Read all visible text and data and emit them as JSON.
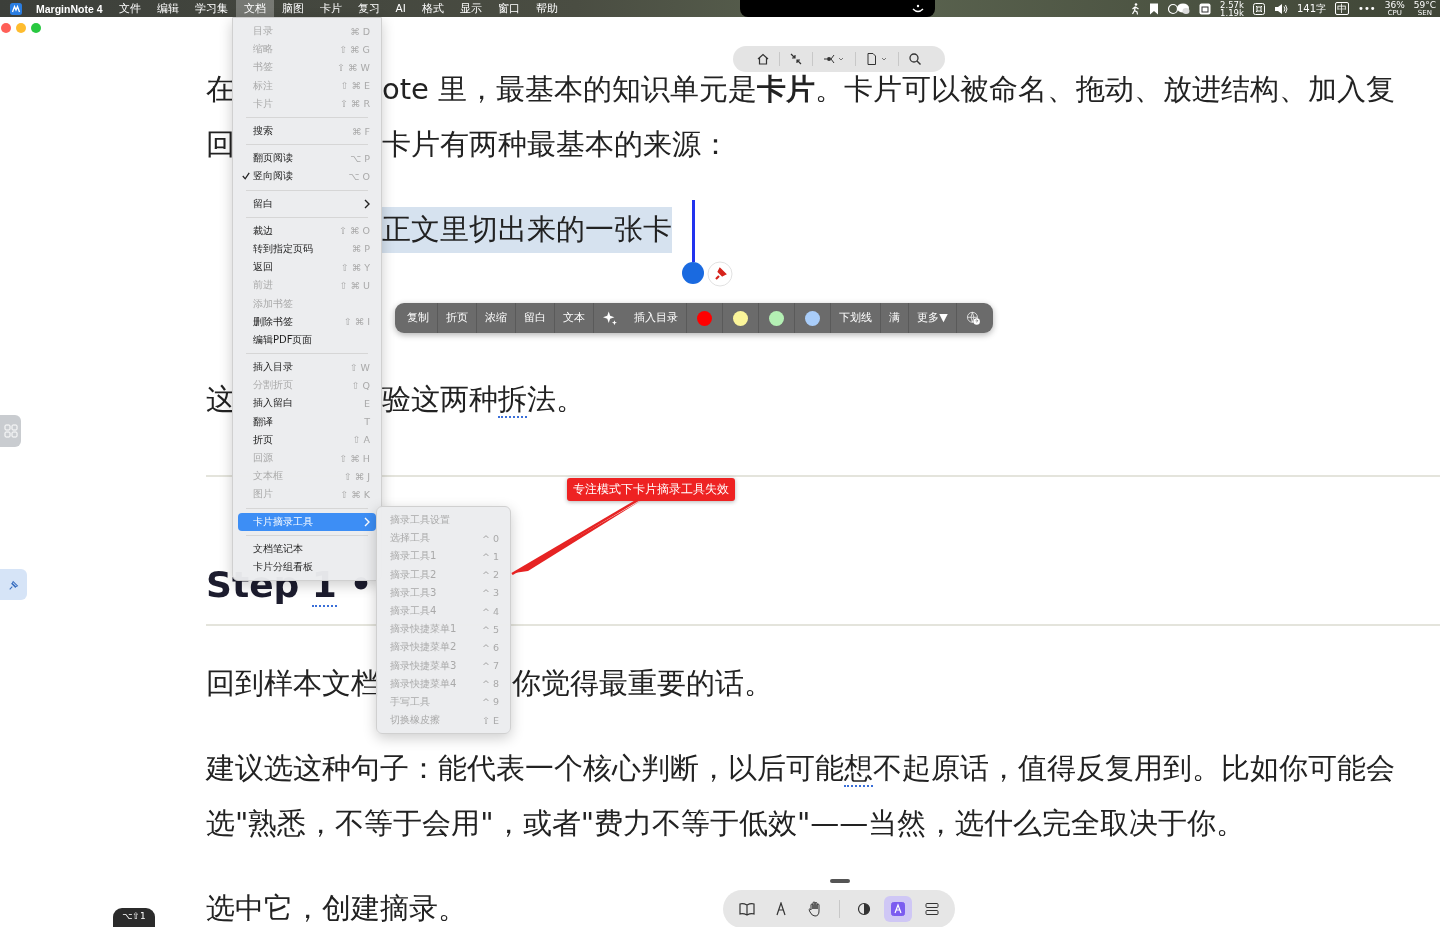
{
  "menu_bar": {
    "app_name": "MarginNote 4",
    "menus": [
      {
        "label": "文件",
        "selected": false
      },
      {
        "label": "编辑",
        "selected": false
      },
      {
        "label": "学习集",
        "selected": false
      },
      {
        "label": "文档",
        "selected": true
      },
      {
        "label": "脑图",
        "selected": false
      },
      {
        "label": "卡片",
        "selected": false
      },
      {
        "label": "复习",
        "selected": false
      },
      {
        "label": "AI",
        "selected": false
      },
      {
        "label": "格式",
        "selected": false
      },
      {
        "label": "显示",
        "selected": false
      },
      {
        "label": "窗口",
        "selected": false
      },
      {
        "label": "帮助",
        "selected": false
      }
    ],
    "net_up": "2.57k",
    "net_down": "1.19k",
    "word_count": "141字",
    "input_method": "中",
    "more": "•••",
    "cpu_value": "36%",
    "cpu_label": "CPU",
    "temp_value": "59°C",
    "temp_label": "SEN"
  },
  "document": [
    {
      "kind": "para",
      "lines": [
        {
          "kind": "menu",
          "left": [
            {
              "text": "在",
              "underline": false
            }
          ],
          "right": [
            {
              "text": "ote  里，最基本的知识单元是**卡片**。卡片可以被命名、拖动、放进结构、加入复",
              "underline": false
            }
          ]
        },
        {
          "kind": "menu",
          "left": [
            {
              "text": "回",
              "underline": false
            }
          ],
          "right": [
            {
              "text": "卡片有两种最基本的来源：",
              "underline": false
            }
          ]
        }
      ]
    },
    {
      "kind": "highlight",
      "lines": [
        {
          "kind": "menu",
          "right": [
            {
              "text": "正文里切出来的一张卡",
              "underline": false
            }
          ]
        }
      ]
    },
    {
      "kind": "hidden"
    },
    {
      "kind": "para",
      "lines": [
        {
          "kind": "menu",
          "left": [
            {
              "text": "这",
              "underline": false
            }
          ],
          "right": [
            {
              "text": "验这两种",
              "underline": false
            },
            {
              "text": "拆",
              "underline": true
            },
            {
              "text": "法。",
              "underline": false
            }
          ]
        }
      ]
    },
    {
      "kind": "rule"
    },
    {
      "kind": "heading",
      "lines": [
        {
          "kind": "full",
          "text": [
            {
              "text": "Step ",
              "underline": false
            },
            {
              "text": "1",
              "underline": true
            },
            {
              "text": " •",
              "underline": false
            }
          ]
        }
      ]
    },
    {
      "kind": "rule"
    },
    {
      "kind": "para",
      "lines": [
        {
          "kind": "submenu",
          "left": [
            {
              "text": "回到样本文档",
              "underline": false
            }
          ],
          "right": [
            {
              "text": "你觉得最重要的话。",
              "underline": false
            }
          ]
        }
      ]
    },
    {
      "kind": "para",
      "lines": [
        {
          "kind": "full",
          "text": [
            {
              "text": "建议选这种句子：能代表一个核心判断，以后可能",
              "underline": false
            },
            {
              "text": "想",
              "underline": true
            },
            {
              "text": "不起原话，值得反复用到。比如你可能会",
              "underline": false
            }
          ]
        },
        {
          "kind": "full",
          "text": [
            {
              "text": "选\"熟悉，不等于会用\"，或者\"费力不等于低效\"——当然，选什么完全取决于你。",
              "underline": false
            }
          ]
        }
      ]
    },
    {
      "kind": "para",
      "lines": [
        {
          "kind": "full",
          "text": [
            {
              "text": "选中它，创建摘录。",
              "underline": false
            }
          ]
        }
      ]
    }
  ],
  "doc_menu": {
    "items": [
      {
        "kind": "item",
        "label": "目录",
        "shortcut": "⌘ D",
        "disabled": true,
        "checked": false,
        "selected": false
      },
      {
        "kind": "item",
        "label": "缩略",
        "shortcut": "⇧ ⌘ G",
        "disabled": true,
        "checked": false,
        "selected": false
      },
      {
        "kind": "item",
        "label": "书签",
        "shortcut": "⇧ ⌘ W",
        "disabled": true,
        "checked": false,
        "selected": false
      },
      {
        "kind": "item",
        "label": "标注",
        "shortcut": "⇧ ⌘ E",
        "disabled": true,
        "checked": false,
        "selected": false
      },
      {
        "kind": "item",
        "label": "卡片",
        "shortcut": "⇧ ⌘ R",
        "disabled": true,
        "checked": false,
        "selected": false
      },
      {
        "kind": "separator"
      },
      {
        "kind": "item",
        "label": "搜索",
        "shortcut": "⌘ F",
        "disabled": false,
        "checked": false,
        "selected": false
      },
      {
        "kind": "separator"
      },
      {
        "kind": "item",
        "label": "翻页阅读",
        "shortcut": "⌥ P",
        "disabled": false,
        "checked": false,
        "selected": false
      },
      {
        "kind": "item",
        "label": "竖向阅读",
        "shortcut": "⌥ O",
        "disabled": false,
        "checked": true,
        "selected": false
      },
      {
        "kind": "separator"
      },
      {
        "kind": "submenu",
        "label": "留白",
        "disabled": false,
        "checked": false,
        "selected": false
      },
      {
        "kind": "separator"
      },
      {
        "kind": "item",
        "label": "裁边",
        "shortcut": "⇧ ⌘ O",
        "disabled": false,
        "checked": false,
        "selected": false
      },
      {
        "kind": "item",
        "label": "转到指定页码",
        "shortcut": "⌘ P",
        "disabled": false,
        "checked": false,
        "selected": false
      },
      {
        "kind": "item",
        "label": "返回",
        "shortcut": "⇧ ⌘ Y",
        "disabled": false,
        "checked": false,
        "selected": false
      },
      {
        "kind": "item",
        "label": "前进",
        "shortcut": "⇧ ⌘ U",
        "disabled": true,
        "checked": false,
        "selected": false
      },
      {
        "kind": "item",
        "label": "添加书签",
        "disabled": true,
        "checked": false,
        "selected": false
      },
      {
        "kind": "item",
        "label": "删除书签",
        "shortcut": "⇧ ⌘ I",
        "disabled": false,
        "checked": false,
        "selected": false
      },
      {
        "kind": "item",
        "label": "编辑PDF页面",
        "disabled": false,
        "checked": false,
        "selected": false
      },
      {
        "kind": "separator"
      },
      {
        "kind": "item",
        "label": "插入目录",
        "shortcut": "⇧ W",
        "disabled": false,
        "checked": false,
        "selected": false
      },
      {
        "kind": "item",
        "label": "分割折页",
        "shortcut": "⇧ Q",
        "disabled": true,
        "checked": false,
        "selected": false
      },
      {
        "kind": "item",
        "label": "插入留白",
        "shortcut": "E",
        "disabled": false,
        "checked": false,
        "selected": false
      },
      {
        "kind": "item",
        "label": "翻译",
        "shortcut": "T",
        "disabled": false,
        "checked": false,
        "selected": false
      },
      {
        "kind": "item",
        "label": "折页",
        "shortcut": "⇧ A",
        "disabled": false,
        "checked": false,
        "selected": false
      },
      {
        "kind": "item",
        "label": "回源",
        "shortcut": "⇧ ⌘ H",
        "disabled": true,
        "checked": false,
        "selected": false
      },
      {
        "kind": "item",
        "label": "文本框",
        "shortcut": "⇧ ⌘ J",
        "disabled": true,
        "checked": false,
        "selected": false
      },
      {
        "kind": "item",
        "label": "图片",
        "shortcut": "⇧ ⌘ K",
        "disabled": true,
        "checked": false,
        "selected": false
      },
      {
        "kind": "separator"
      },
      {
        "kind": "submenu",
        "label": "卡片摘录工具",
        "disabled": false,
        "checked": false,
        "selected": true
      },
      {
        "kind": "separator"
      },
      {
        "kind": "item",
        "label": "文档笔记本",
        "disabled": false,
        "checked": false,
        "selected": false
      },
      {
        "kind": "item",
        "label": "卡片分组看板",
        "disabled": false,
        "checked": false,
        "selected": false
      }
    ]
  },
  "excerpt_submenu": {
    "items": [
      {
        "label": "摘录工具设置",
        "disabled": true
      },
      {
        "label": "选择工具",
        "shortcut": "^ 0",
        "disabled": true
      },
      {
        "label": "摘录工具1",
        "shortcut": "^ 1",
        "disabled": true
      },
      {
        "label": "摘录工具2",
        "shortcut": "^ 2",
        "disabled": true
      },
      {
        "label": "摘录工具3",
        "shortcut": "^ 3",
        "disabled": true
      },
      {
        "label": "摘录工具4",
        "shortcut": "^ 4",
        "disabled": true
      },
      {
        "label": "摘录快捷菜单1",
        "shortcut": "^ 5",
        "disabled": true
      },
      {
        "label": "摘录快捷菜单2",
        "shortcut": "^ 6",
        "disabled": true
      },
      {
        "label": "摘录快捷菜单3",
        "shortcut": "^ 7",
        "disabled": true
      },
      {
        "label": "摘录快捷菜单4",
        "shortcut": "^ 8",
        "disabled": true
      },
      {
        "label": "手写工具",
        "shortcut": "^ 9",
        "disabled": true
      },
      {
        "label": "切换橡皮擦",
        "shortcut": "⇧ E",
        "disabled": true
      }
    ]
  },
  "selection_toolbar": {
    "items": [
      {
        "kind": "text",
        "label": "复制"
      },
      {
        "kind": "text",
        "label": "折页"
      },
      {
        "kind": "text",
        "label": "浓缩"
      },
      {
        "kind": "text",
        "label": "留白"
      },
      {
        "kind": "text",
        "label": "文本"
      },
      {
        "kind": "sparkle"
      },
      {
        "kind": "text",
        "label": "插入目录"
      },
      {
        "kind": "swatch",
        "color": "#ff0000"
      },
      {
        "kind": "swatch",
        "color": "#fbf59a"
      },
      {
        "kind": "swatch",
        "color": "#b4f0b4"
      },
      {
        "kind": "swatch",
        "color": "#a9cdf9"
      },
      {
        "kind": "text",
        "label": "下划线"
      },
      {
        "kind": "text",
        "label": "满"
      },
      {
        "kind": "text",
        "label": "更多▼"
      },
      {
        "kind": "globe"
      }
    ]
  },
  "bottom_toolbar": {
    "tools": [
      {
        "kind": "book",
        "selected": false
      },
      {
        "kind": "pen",
        "selected": false
      },
      {
        "kind": "hand",
        "selected": false
      },
      {
        "kind": "contrast",
        "selected": false
      },
      {
        "kind": "text-mode",
        "selected": true
      },
      {
        "kind": "layers",
        "selected": false
      }
    ]
  },
  "annotation": {
    "text": "专注模式下卡片摘录工具失效"
  },
  "shortcut_badge": "⌥⇧1"
}
